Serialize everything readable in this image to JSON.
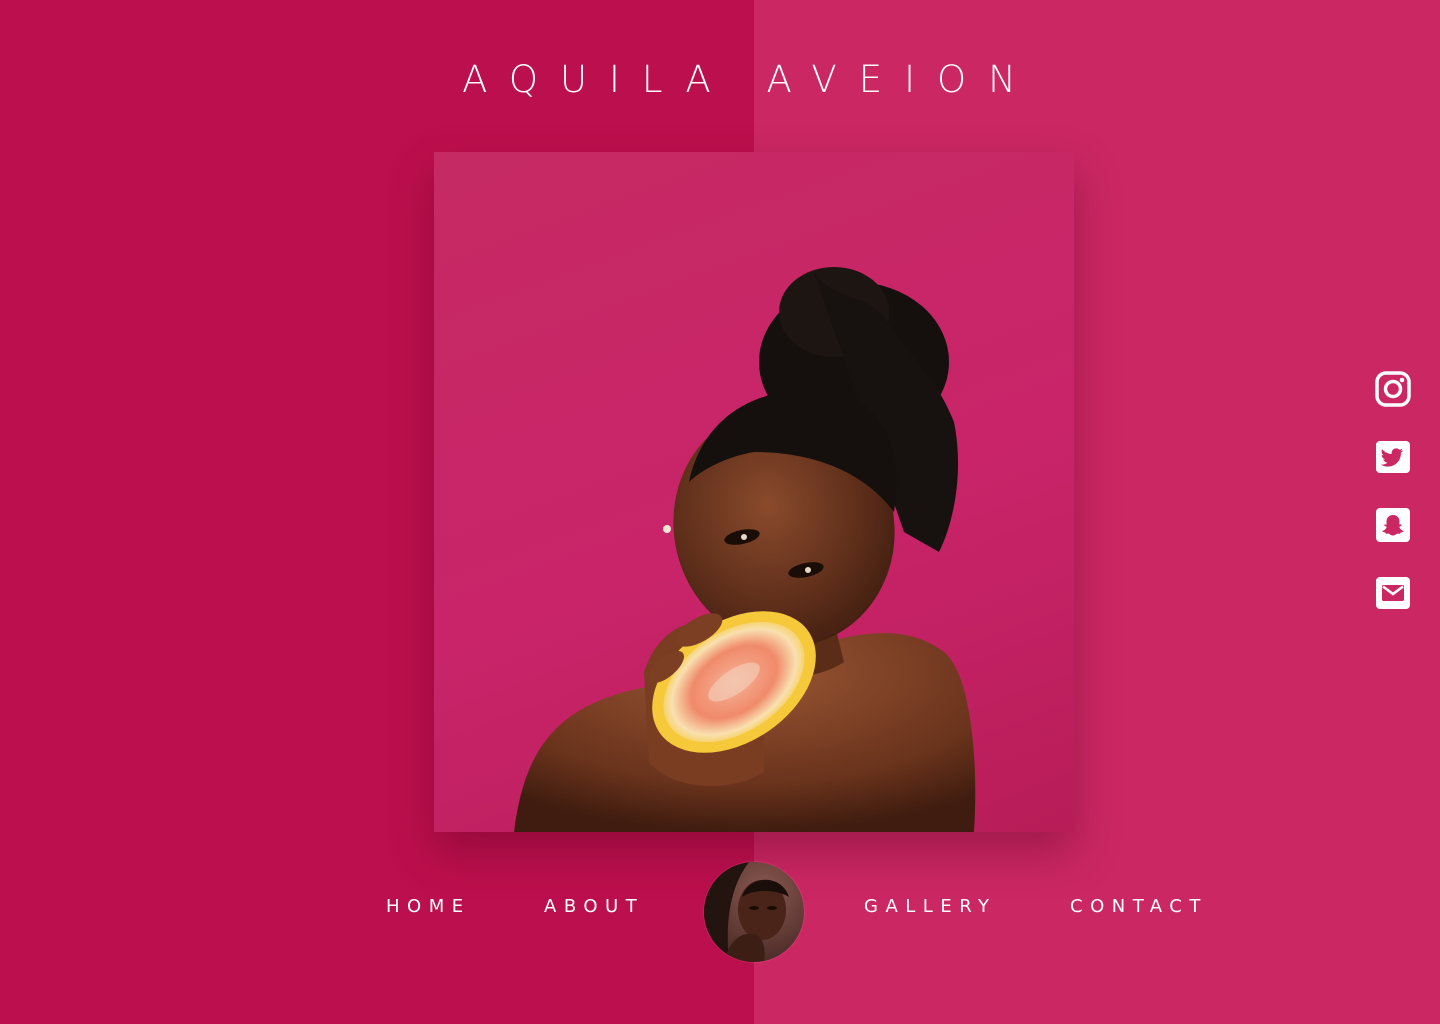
{
  "site": {
    "title": "AQUILA AVEION"
  },
  "colors": {
    "left_panel": "#bc0f4d",
    "right_panel": "#cb2763",
    "text": "#ffffff"
  },
  "nav": {
    "items": [
      {
        "label": "HOME"
      },
      {
        "label": "ABOUT"
      },
      {
        "label": "GALLERY"
      },
      {
        "label": "CONTACT"
      }
    ]
  },
  "social": {
    "icons": [
      "instagram-icon",
      "twitter-icon",
      "snapchat-icon",
      "mail-icon"
    ]
  }
}
